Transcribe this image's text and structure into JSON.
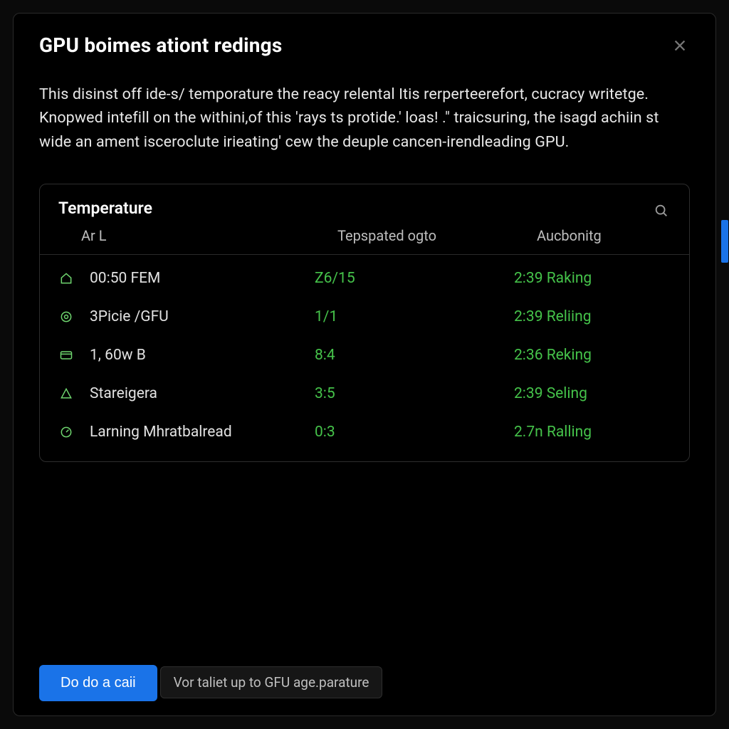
{
  "dialog": {
    "title": "GPU boimes ationt redings",
    "description": "This disinst off ide-s/ temporature the reacy relental Itis rerperteerefort, cucracy writetge. Knopwed intefill on the withini,of this 'rays ts protide.' loas! .\" traicsuring, the isagd achiin st wide an ament isceroclute irieating' cew the deuple cancen-irendleading GPU."
  },
  "panel": {
    "title": "Temperature",
    "columns": {
      "c0": "Ar L",
      "c1": "Tepspated ogto",
      "c2": "Aucbonitg"
    }
  },
  "rows": [
    {
      "icon": "house-icon",
      "label": "00:50 FEM",
      "v1": "Z6/15",
      "v2": "2:39 Raking"
    },
    {
      "icon": "target-icon",
      "label": "3Picie /GFU",
      "v1": "1/1",
      "v2": "2:39 Reliing"
    },
    {
      "icon": "card-icon",
      "label": "1, 60w B",
      "v1": "8:4",
      "v2": "2:36 Reking"
    },
    {
      "icon": "triangle-icon",
      "label": "Stareigera",
      "v1": "3:5",
      "v2": "2:39 Seling"
    },
    {
      "icon": "gauge-icon",
      "label": "Larning Mhratbalread",
      "v1": "0:3",
      "v2": "2.7n Ralling"
    }
  ],
  "footer": {
    "primary_label": "Do do a caii",
    "hint": "Vor taliet up to GFU age.parature"
  }
}
